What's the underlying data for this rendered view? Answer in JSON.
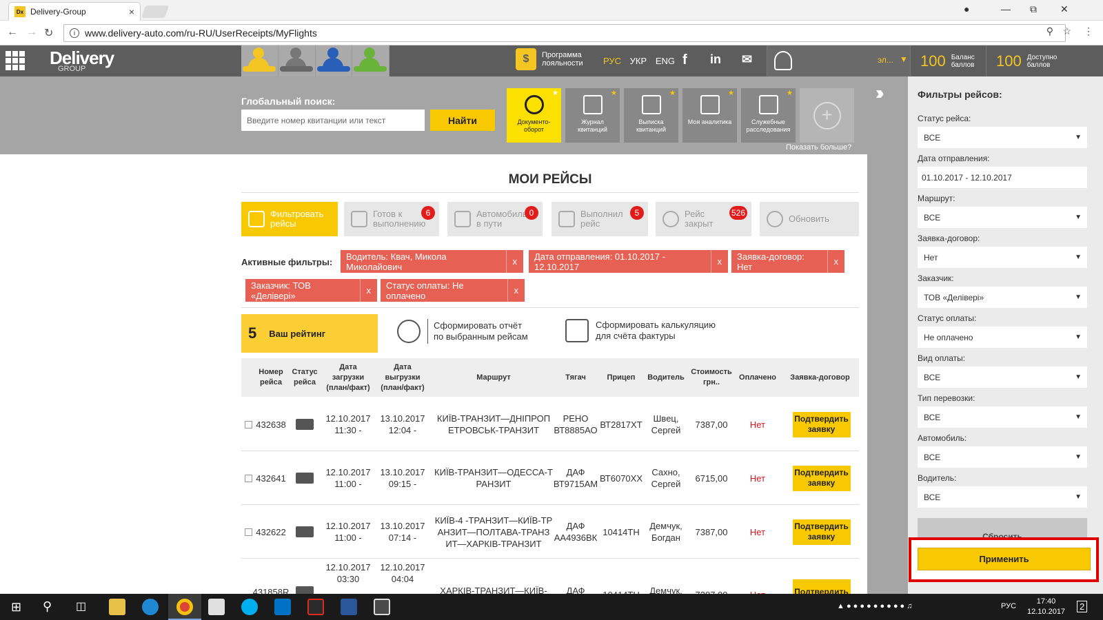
{
  "browser": {
    "tab_title": "Delivery-Group",
    "favicon_text": "Dx",
    "tab_close": "×",
    "url": "www.delivery-auto.com/ru-RU/UserReceipts/MyFlights"
  },
  "header": {
    "logo_main": "Delivery",
    "logo_sub": "GROUP",
    "loyalty_line1": "Программа",
    "loyalty_line2": "лояльности",
    "languages": [
      "РУС",
      "УКР",
      "ENG"
    ],
    "user_name": "эл...",
    "balance": {
      "value": "100",
      "line1": "Баланс",
      "line2": "баллов"
    },
    "available": {
      "value": "100",
      "line1": "Доступно",
      "line2": "баллов"
    }
  },
  "search": {
    "label": "Глобальный поиск:",
    "placeholder": "Введите номер квитанции или текст",
    "button": "Найти"
  },
  "tiles": [
    {
      "line1": "Документо-",
      "line2": "оборот"
    },
    {
      "line1": "Журнал",
      "line2": "квитанций"
    },
    {
      "line1": "Выписка",
      "line2": "квитанций"
    },
    {
      "line1": "Моя аналитика",
      "line2": ""
    },
    {
      "line1": "Служебные",
      "line2": "расследования"
    }
  ],
  "show_more": "Показать больше?",
  "page_title": "МОИ РЕЙСЫ",
  "filter_buttons": [
    {
      "line1": "Фильтровать",
      "line2": "рейсы",
      "badge": ""
    },
    {
      "line1": "Готов к",
      "line2": "выполнению",
      "badge": "6"
    },
    {
      "line1": "Автомобиль",
      "line2": "в пути",
      "badge": "0"
    },
    {
      "line1": "Выполнил",
      "line2": "рейс",
      "badge": "5"
    },
    {
      "line1": "Рейс",
      "line2": "закрыт",
      "badge": "526"
    },
    {
      "line1": "Обновить",
      "line2": "",
      "badge": ""
    }
  ],
  "active_filters": {
    "label": "Активные фильтры:",
    "chips": [
      "Водитель: Квач, Микола Миколайович",
      "Дата отправления: 01.10.2017 - 12.10.2017",
      "Заявка-договор: Нет",
      "Заказчик: ТОВ «Делівері»",
      "Статус оплаты: Не оплачено"
    ],
    "remove": "x"
  },
  "rating": {
    "value": "5",
    "label": "Ваш рейтинг"
  },
  "actions": {
    "report_line1": "Сформировать отчёт",
    "report_line2": "по выбранным рейсам",
    "calc_line1": "Сформировать калькуляцию",
    "calc_line2": "для счёта фактуры"
  },
  "table": {
    "headers": [
      "Номер рейса",
      "Статус рейса",
      "Дата загрузки (план/факт)",
      "Дата выгрузки (план/факт)",
      "Маршрут",
      "Тягач",
      "Прицеп",
      "Водитель",
      "Стоимость грн..",
      "Оплачено",
      "Заявка-договор"
    ],
    "rows": [
      {
        "num": "432638",
        "load": "12.10.2017 11:30 -",
        "unload": "13.10.2017 12:04 -",
        "route": "КИЇВ-ТРАНЗИТ—ДНІПРОПЕТРОВСЬК-ТРАНЗИТ",
        "tractor": "РЕНО ВТ8885АО",
        "trailer": "ВТ2817ХТ",
        "driver": "Швец, Сергей",
        "cost": "7387,00",
        "paid": "Нет",
        "action": "Подтвердить заявку"
      },
      {
        "num": "432641",
        "load": "12.10.2017 11:00 -",
        "unload": "13.10.2017 09:15 -",
        "route": "КИЇВ-ТРАНЗИТ—ОДЕССА-ТРАНЗИТ",
        "tractor": "ДАФ ВТ9715АМ",
        "trailer": "ВТ6070ХХ",
        "driver": "Сахно, Сергей",
        "cost": "6715,00",
        "paid": "Нет",
        "action": "Подтвердить заявку"
      },
      {
        "num": "432622",
        "load": "12.10.2017 11:00 -",
        "unload": "13.10.2017 07:14 -",
        "route": "КИЇВ-4 -ТРАНЗИТ—КИЇВ-ТРАНЗИТ—ПОЛТАВА-ТРАНЗИТ—ХАРКІВ-ТРАНЗИТ",
        "tractor": "ДАФ АА4936ВК",
        "trailer": "10414ТН",
        "driver": "Демчук, Богдан",
        "cost": "7387,00",
        "paid": "Нет",
        "action": "Подтвердить заявку"
      },
      {
        "num": "431858R",
        "load": "12.10.2017 03:30",
        "unload": "12.10.2017 04:04",
        "route": "ХАРКІВ-ТРАНЗИТ—КИЇВ-",
        "tractor": "ДАФ",
        "trailer": "10414ТН",
        "driver": "Демчук,",
        "cost": "7387,00",
        "paid": "Нет",
        "action": "Подтвердить"
      }
    ]
  },
  "filters_panel": {
    "title": "Фильтры рейсов:",
    "fields": [
      {
        "label": "Статус рейса:",
        "value": "ВСЕ"
      },
      {
        "label": "Дата отправления:",
        "value": "01.10.2017 - 12.10.2017"
      },
      {
        "label": "Маршрут:",
        "value": "ВСЕ"
      },
      {
        "label": "Заявка-договор:",
        "value": "Нет"
      },
      {
        "label": "Заказчик:",
        "value": "ТОВ «Делівері»"
      },
      {
        "label": "Статус оплаты:",
        "value": "Не оплачено"
      },
      {
        "label": "Вид оплаты:",
        "value": "ВСЕ"
      },
      {
        "label": "Тип перевозки:",
        "value": "ВСЕ"
      },
      {
        "label": "Автомобиль:",
        "value": "ВСЕ"
      },
      {
        "label": "Водитель:",
        "value": "ВСЕ"
      }
    ],
    "reset": "Сбросить",
    "apply": "Применить"
  },
  "taskbar": {
    "lang": "РУС",
    "time": "17:40",
    "date": "12.10.2017",
    "notif_count": "2"
  },
  "colors": {
    "accent": "#f8c900",
    "chip": "#e66053",
    "badge": "#e21b1b",
    "highlight": "#e00000"
  }
}
